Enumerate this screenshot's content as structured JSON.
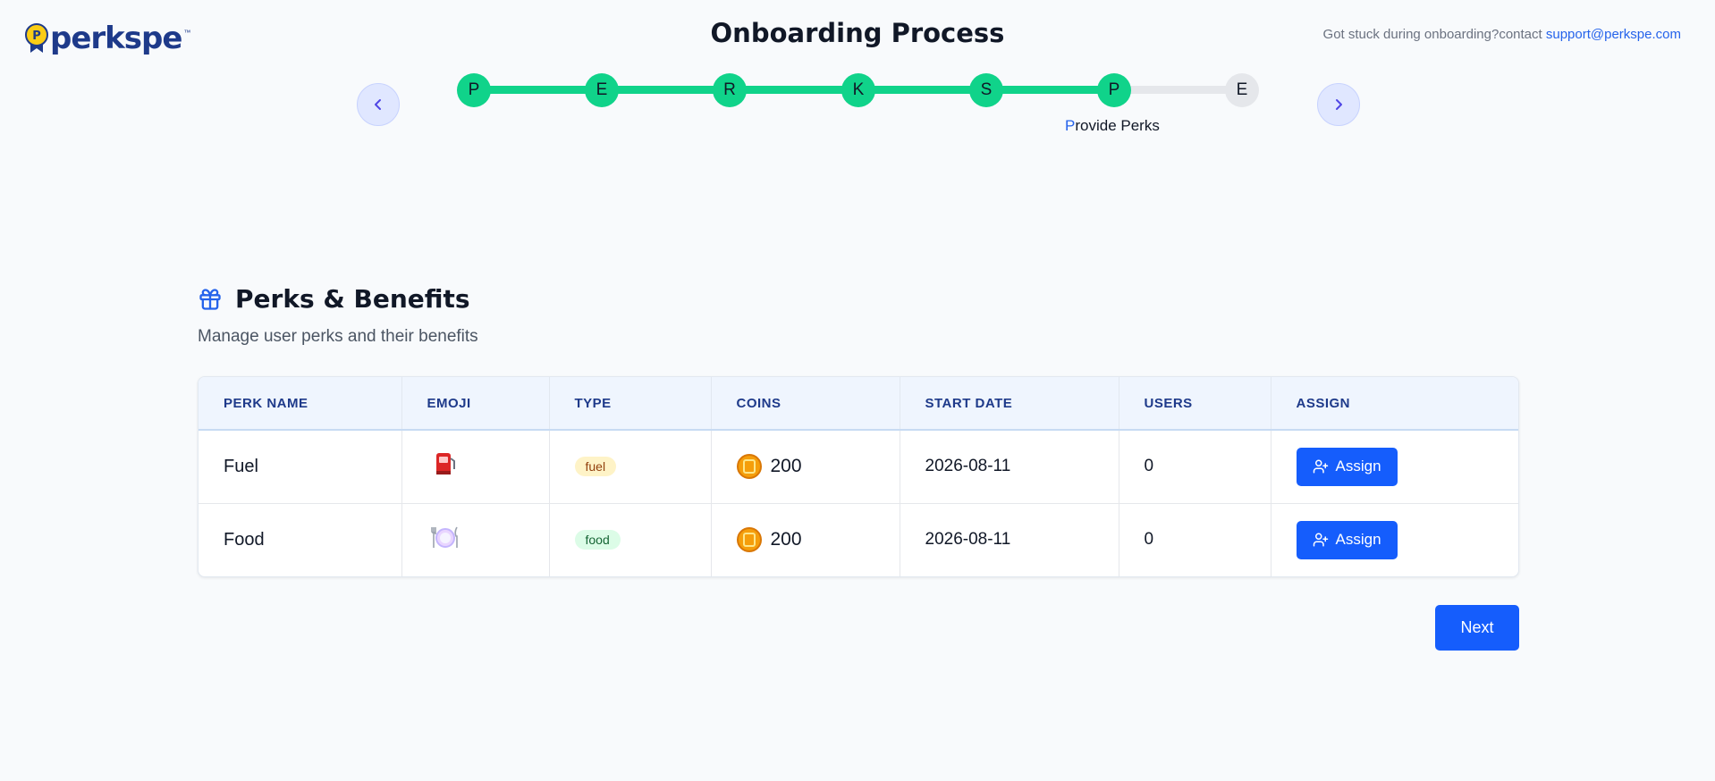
{
  "brand": {
    "name": "perkspe",
    "tm": "™",
    "badge_letter": "P",
    "color": "#1e3a8a"
  },
  "header": {
    "title": "Onboarding Process",
    "support_text": "Got stuck during onboarding?contact ",
    "support_email": "support@perkspe.com"
  },
  "stepper": {
    "steps": [
      {
        "letter": "P",
        "state": "done"
      },
      {
        "letter": "E",
        "state": "done"
      },
      {
        "letter": "R",
        "state": "done"
      },
      {
        "letter": "K",
        "state": "done"
      },
      {
        "letter": "S",
        "state": "done"
      },
      {
        "letter": "P",
        "state": "current"
      },
      {
        "letter": "E",
        "state": "todo"
      }
    ],
    "current_label_first": "P",
    "current_label_rest": "rovide Perks",
    "accent": "#10d38a"
  },
  "section": {
    "title": "Perks & Benefits",
    "subtitle": "Manage user perks and their benefits",
    "icon": "gift-icon"
  },
  "table": {
    "columns": [
      "PERK NAME",
      "EMOJI",
      "TYPE",
      "COINS",
      "START DATE",
      "USERS",
      "ASSIGN"
    ],
    "rows": [
      {
        "name": "Fuel",
        "emoji": "fuel-pump-icon",
        "type": "fuel",
        "coins": "200",
        "start_date": "2026-08-11",
        "users": "0",
        "assign_label": "Assign"
      },
      {
        "name": "Food",
        "emoji": "plate-cutlery-icon",
        "type": "food",
        "coins": "200",
        "start_date": "2026-08-11",
        "users": "0",
        "assign_label": "Assign"
      }
    ]
  },
  "footer": {
    "next_label": "Next"
  },
  "colors": {
    "primary": "#155dfc",
    "link": "#2563eb"
  }
}
